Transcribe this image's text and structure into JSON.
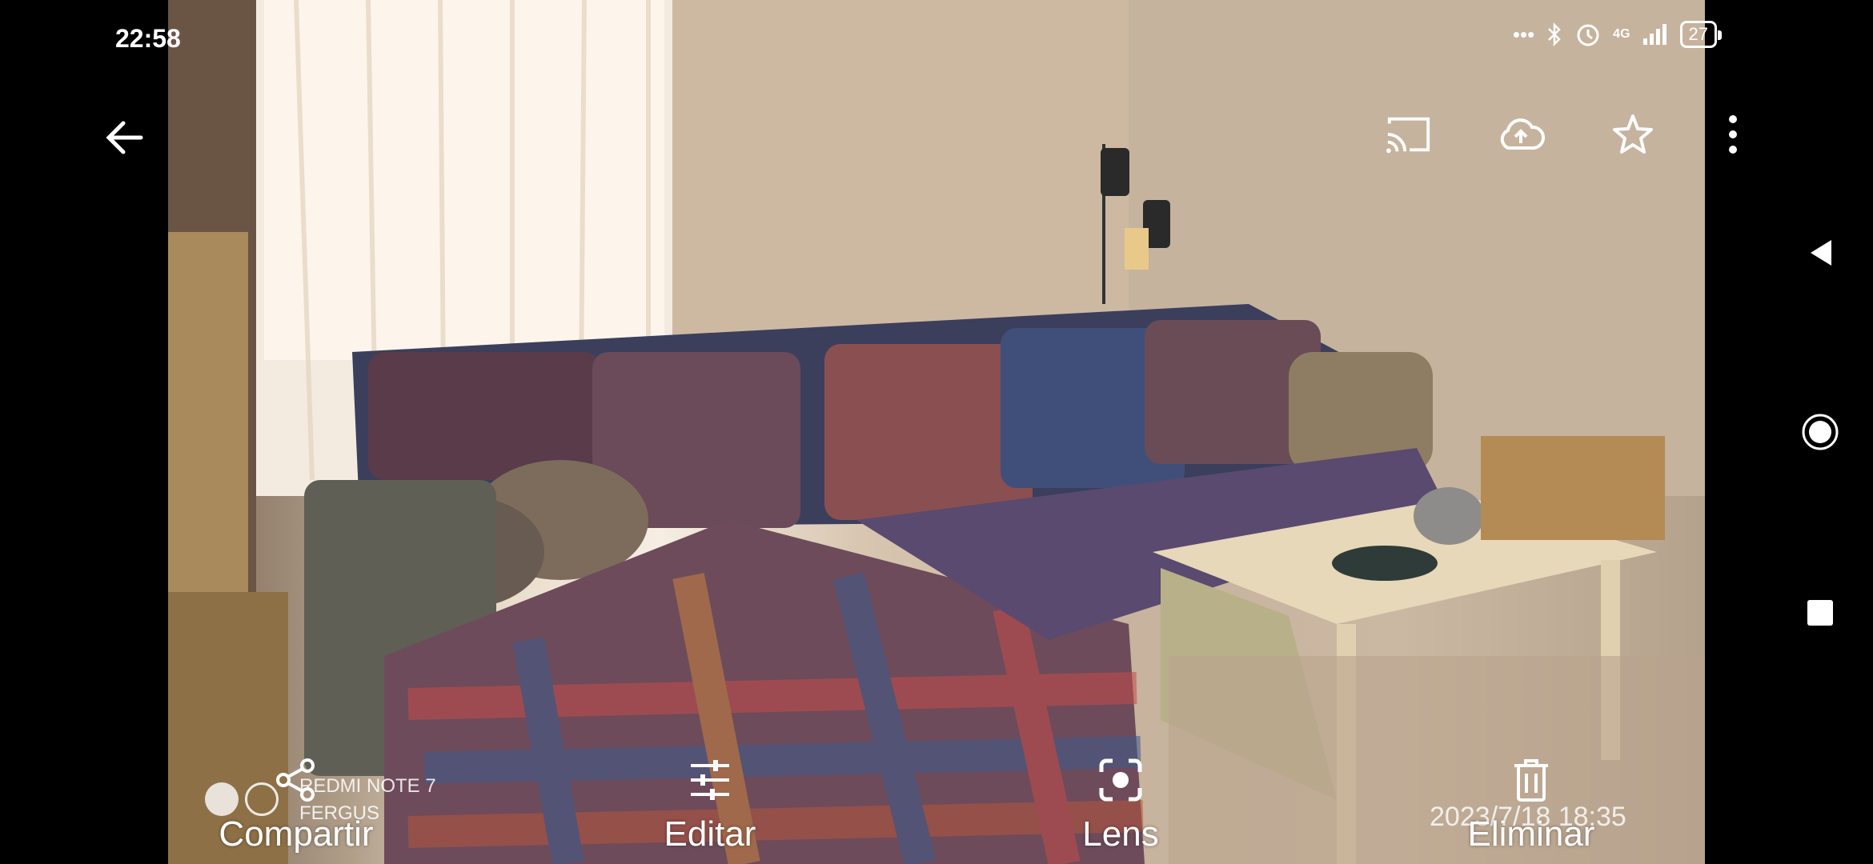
{
  "status_bar": {
    "time": "22:58",
    "indicators": [
      "...",
      "bluetooth-icon",
      "alarm-icon",
      "4G",
      "signal-icon"
    ],
    "network": "4G",
    "battery": "27"
  },
  "top_bar": {
    "back_icon": "arrow-left-icon",
    "actions": [
      "cast-icon",
      "cloud-upload-icon",
      "star-icon",
      "more-vert-icon"
    ]
  },
  "photo": {
    "watermark_device": "REDMI NOTE 7",
    "watermark_user": "FERGUS",
    "watermark_timestamp": "2023/7/18  18:35"
  },
  "bottom_bar": {
    "share_label": "Compartir",
    "edit_label": "Editar",
    "lens_label": "Lens",
    "delete_label": "Eliminar"
  },
  "nav": {
    "back": "triangle-back-icon",
    "home": "circle-home-icon",
    "recents": "square-recents-icon"
  },
  "colors": {
    "background": "#000000",
    "icon": "#ffffff"
  }
}
